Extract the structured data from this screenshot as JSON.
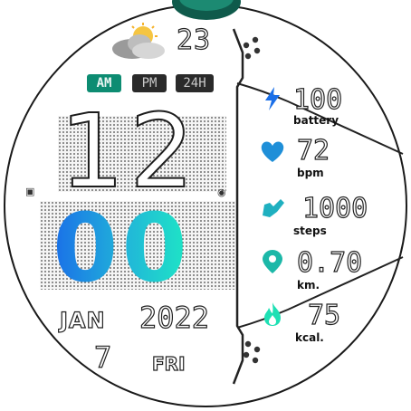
{
  "weather": {
    "icon": "partly-cloudy-icon",
    "temperature": "23"
  },
  "time_format": {
    "am": "AM",
    "pm": "PM",
    "h24": "24H"
  },
  "time": {
    "hours": "12",
    "minutes": "00"
  },
  "date": {
    "month": "JAN",
    "year": "2022",
    "day": "7",
    "weekday": "FRI"
  },
  "stats": [
    {
      "icon": "lightning-icon",
      "value": "100",
      "label": "battery"
    },
    {
      "icon": "heart-icon",
      "value": "72",
      "label": "bpm"
    },
    {
      "icon": "shoe-icon",
      "value": "1000",
      "label": "steps"
    },
    {
      "icon": "location-pin-icon",
      "value": "0.70",
      "label": "km."
    },
    {
      "icon": "flame-icon",
      "value": "75",
      "label": "kcal."
    }
  ],
  "colors": {
    "accent": "#0d8c72",
    "teal": "#1fb89a",
    "blue": "#1a6fe8",
    "cyan": "#1ee8c4"
  }
}
